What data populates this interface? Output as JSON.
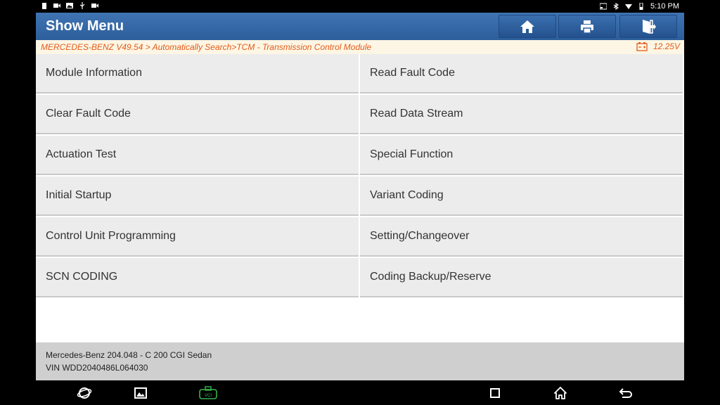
{
  "status_bar": {
    "time": "5:10 PM",
    "left_icons": [
      "battery-icon",
      "video-icon",
      "image-icon",
      "usb-icon",
      "video-icon"
    ],
    "right_icons": [
      "cast-icon",
      "bluetooth-icon",
      "wifi-icon",
      "battery-icon"
    ]
  },
  "header": {
    "title": "Show Menu",
    "buttons": [
      "home-icon",
      "print-icon",
      "exit-icon"
    ]
  },
  "breadcrumb": {
    "path": "MERCEDES-BENZ V49.54 > Automatically Search>TCM - Transmission Control Module",
    "voltage": "12.25V"
  },
  "menu": {
    "items": [
      "Module Information",
      "Read Fault Code",
      "Clear Fault Code",
      "Read Data Stream",
      "Actuation Test",
      "Special Function",
      "Initial Startup",
      "Variant Coding",
      "Control Unit Programming",
      "Setting/Changeover",
      "SCN CODING",
      "Coding Backup/Reserve"
    ]
  },
  "vehicle": {
    "model": "Mercedes-Benz 204.048 - C 200 CGI Sedan",
    "vin": "VIN WDD2040486L064030"
  },
  "nav_bar": {
    "icons": [
      "browser-icon",
      "gallery-icon",
      "vci-icon",
      "recents-icon",
      "home-icon",
      "back-icon"
    ],
    "vci_label": "VCI"
  },
  "colors": {
    "header": "#2d5e9c",
    "breadcrumb_text": "#e35b1a",
    "breadcrumb_bg": "#fdf6e4",
    "cell_bg": "#ececec",
    "footer_bg": "#cfcfcf",
    "vci_accent": "#37b34a"
  }
}
